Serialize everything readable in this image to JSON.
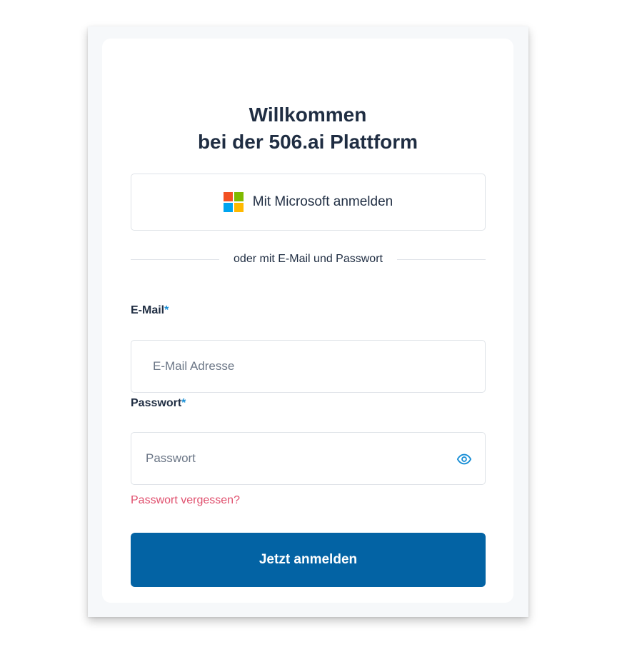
{
  "header": {
    "title_line1": "Willkommen",
    "title_line2": "bei der 506.ai Plattform"
  },
  "microsoft_login": {
    "label": "Mit Microsoft anmelden",
    "logo_colors": [
      "#f25022",
      "#7fba00",
      "#00a4ef",
      "#ffb900"
    ],
    "icon": "microsoft-logo-icon"
  },
  "divider": {
    "text": "oder mit E-Mail und Passwort"
  },
  "email": {
    "label": "E-Mail",
    "required_marker": "*",
    "placeholder": "E-Mail Adresse",
    "value": ""
  },
  "password": {
    "label": "Passwort",
    "required_marker": "*",
    "placeholder": "Passwort",
    "value": "",
    "toggle_icon": "eye-icon"
  },
  "forgot_password": {
    "label": "Passwort vergessen?"
  },
  "submit": {
    "label": "Jetzt anmelden"
  },
  "colors": {
    "primary": "#0363a4",
    "link": "#e0506e",
    "required": "#1a8fd6",
    "text": "#1f2d42"
  }
}
